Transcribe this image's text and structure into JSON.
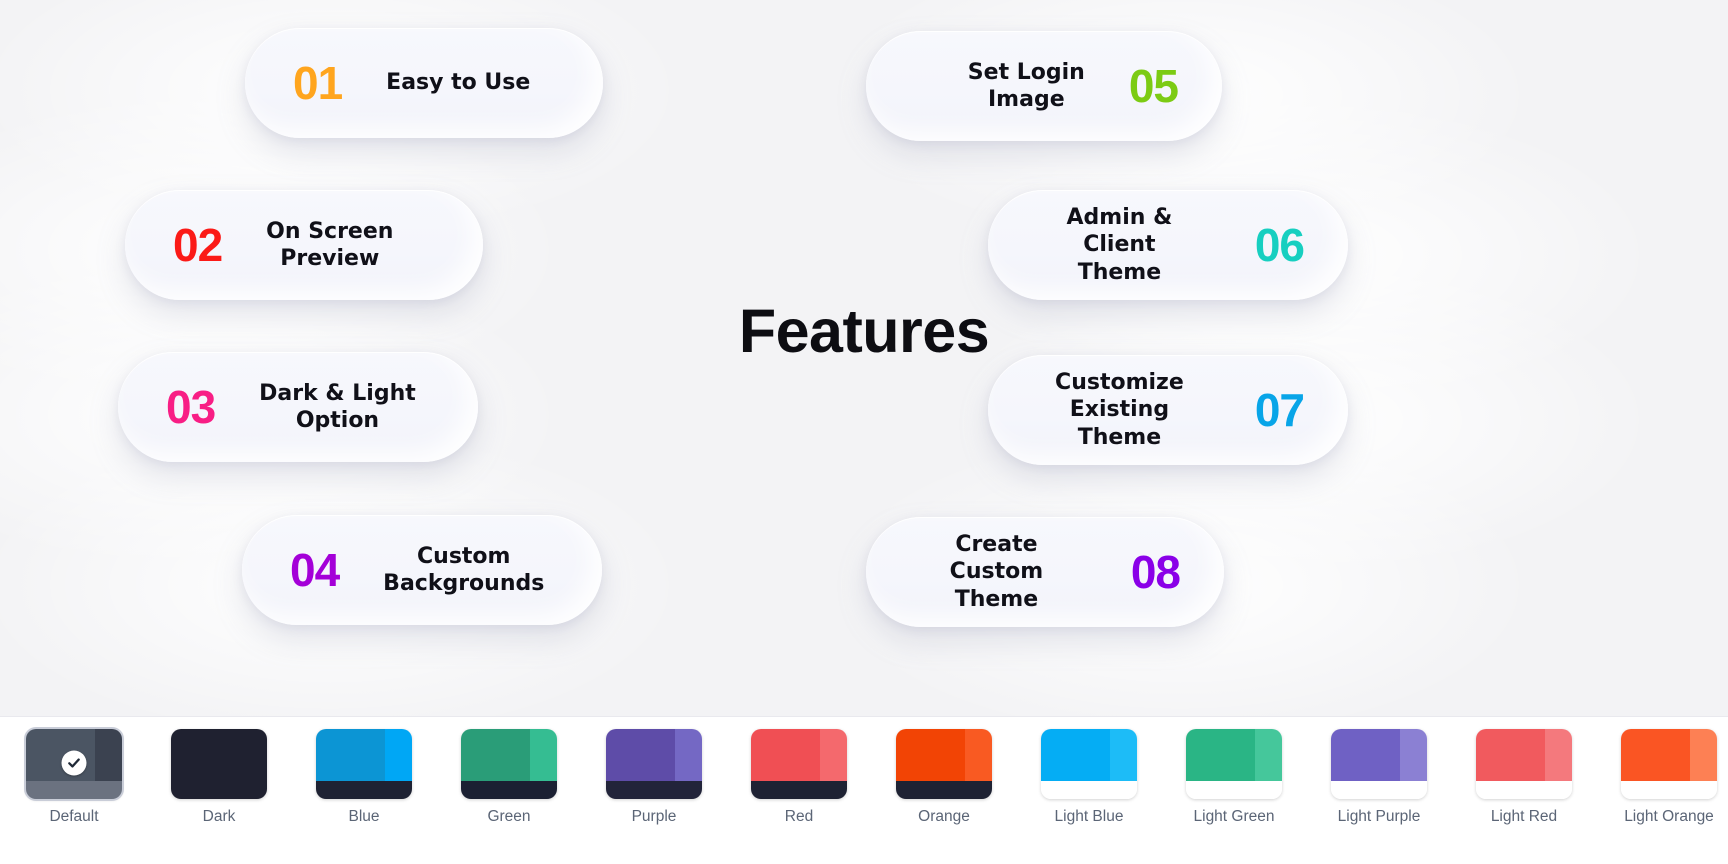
{
  "page": {
    "title": "Features",
    "background_color": "#f3f3f5"
  },
  "features": {
    "left": [
      {
        "number": "01",
        "number_color": "#FFA51E",
        "label": "Easy to Use"
      },
      {
        "number": "02",
        "number_color": "#FB1A17",
        "label": "On Screen\nPreview"
      },
      {
        "number": "03",
        "number_color": "#F81E85",
        "label": "Dark & Light\nOption"
      },
      {
        "number": "04",
        "number_color": "#A400D8",
        "label": "Custom\nBackgrounds"
      }
    ],
    "right": [
      {
        "number": "05",
        "number_color": "#7CCB14",
        "label": "Set Login\nImage"
      },
      {
        "number": "06",
        "number_color": "#17CFC0",
        "label": "Admin & Client\nTheme"
      },
      {
        "number": "07",
        "number_color": "#08A5E8",
        "label": "Customize\nExisting Theme"
      },
      {
        "number": "08",
        "number_color": "#8A00E8",
        "label": "Create Custom\nTheme"
      }
    ]
  },
  "theme_bar": {
    "selected": "Default",
    "check_icon": "check-circle-icon",
    "themes": [
      {
        "label": "Default",
        "main": "#4b5563",
        "accent": "#3b4250",
        "foot": "#6b7280",
        "selected": true
      },
      {
        "label": "Dark",
        "main": "#1f2130",
        "accent": "#1f2130",
        "foot": "#1f2130",
        "selected": false
      },
      {
        "label": "Blue",
        "main": "#0c95d4",
        "accent": "#00a7f5",
        "foot": "#1e2233",
        "selected": false
      },
      {
        "label": "Green",
        "main": "#2a9d78",
        "accent": "#35bd92",
        "foot": "#1b2032",
        "selected": false
      },
      {
        "label": "Purple",
        "main": "#5e4ca8",
        "accent": "#7468c4",
        "foot": "#22243a",
        "selected": false
      },
      {
        "label": "Red",
        "main": "#f04f54",
        "accent": "#f4696d",
        "foot": "#1e2233",
        "selected": false
      },
      {
        "label": "Orange",
        "main": "#f24405",
        "accent": "#f95a22",
        "foot": "#1e2233",
        "selected": false
      },
      {
        "label": "Light Blue",
        "main": "#05adf4",
        "accent": "#1dbcf7",
        "foot": "#ffffff",
        "selected": false
      },
      {
        "label": "Light Green",
        "main": "#2ab585",
        "accent": "#45c79b",
        "foot": "#ffffff",
        "selected": false
      },
      {
        "label": "Light Purple",
        "main": "#6f61c4",
        "accent": "#8b80d3",
        "foot": "#ffffff",
        "selected": false
      },
      {
        "label": "Light Red",
        "main": "#f15a5e",
        "accent": "#f4797d",
        "foot": "#ffffff",
        "selected": false
      },
      {
        "label": "Light Orange",
        "main": "#fa5523",
        "accent": "#fd8054",
        "foot": "#ffffff",
        "selected": false
      }
    ]
  }
}
